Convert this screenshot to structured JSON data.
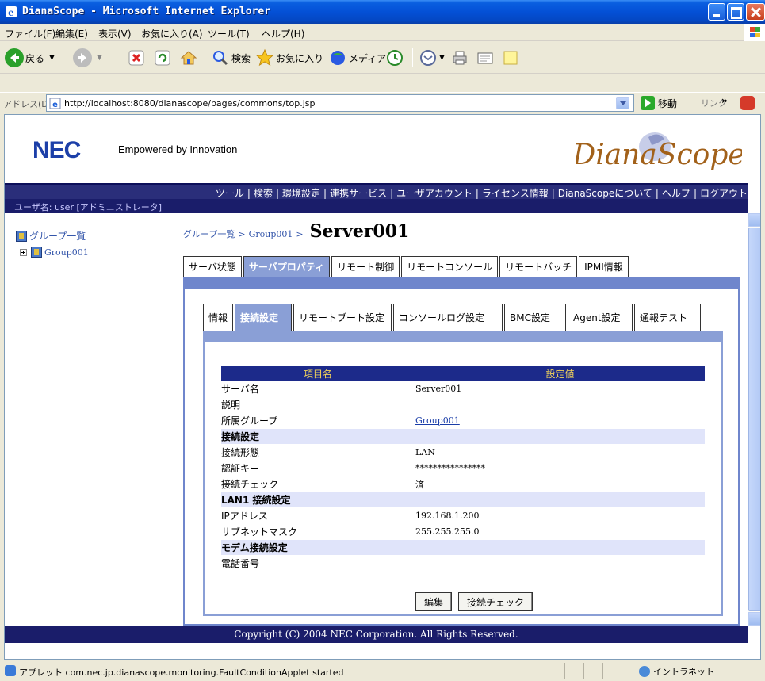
{
  "window": {
    "title": "DianaScope - Microsoft Internet Explorer"
  },
  "menubar": {
    "items": [
      "ファイル(F)",
      "編集(E)",
      "表示(V)",
      "お気に入り(A)",
      "ツール(T)",
      "ヘルプ(H)"
    ]
  },
  "toolbar": {
    "back_label": "戻る",
    "search_label": "検索",
    "favorites_label": "お気に入り",
    "media_label": "メディア"
  },
  "address": {
    "label": "アドレス(D)",
    "url": "http://localhost:8080/dianascope/pages/commons/top.jsp",
    "go_label": "移動",
    "links_label": "リンク"
  },
  "banner": {
    "logo": "NEC",
    "tagline": "Empowered by Innovation",
    "product_logo": "DianaScope"
  },
  "nav": {
    "links": [
      "ツール",
      "検索",
      "環境設定",
      "連携サービス",
      "ユーザアカウント",
      "ライセンス情報",
      "DianaScopeについて",
      "ヘルプ",
      "ログアウト"
    ]
  },
  "user": {
    "text": "ユーザ名: user [アドミニストレータ]"
  },
  "sidebar": {
    "root_label": "グループ一覧",
    "child_label": "Group001"
  },
  "breadcrumb": {
    "root": "グループ一覧",
    "separator": ">",
    "group": "Group001",
    "server": "Server001"
  },
  "main_tabs": [
    "サーバ状態",
    "サーバプロパティ",
    "リモート制御",
    "リモートコンソール",
    "リモートバッチ",
    "IPMI情報"
  ],
  "sub_tabs": [
    "情報",
    "接続設定",
    "リモートブート設定",
    "コンソールログ設定",
    "BMC設定",
    "Agent設定",
    "通報テスト"
  ],
  "table": {
    "header_key": "項目名",
    "header_value": "設定値",
    "rows": [
      {
        "key": "サーバ名",
        "value": "Server001",
        "section": false
      },
      {
        "key": "説明",
        "value": "",
        "section": false
      },
      {
        "key": "所属グループ",
        "value": "Group001",
        "section": false,
        "link": true
      },
      {
        "key": "接続設定",
        "value": "",
        "section": true
      },
      {
        "key": "接続形態",
        "value": "LAN",
        "section": false
      },
      {
        "key": "認証キー",
        "value": "****************",
        "section": false
      },
      {
        "key": "接続チェック",
        "value": "済",
        "section": false
      },
      {
        "key": "LAN1 接続設定",
        "value": "",
        "section": true
      },
      {
        "key": "IPアドレス",
        "value": "192.168.1.200",
        "section": false
      },
      {
        "key": "サブネットマスク",
        "value": "255.255.255.0",
        "section": false
      },
      {
        "key": "モデム接続設定",
        "value": "",
        "section": true
      },
      {
        "key": "電話番号",
        "value": "",
        "section": false
      }
    ]
  },
  "buttons": {
    "edit": "編集",
    "check": "接続チェック"
  },
  "footer": {
    "text": "Copyright (C) 2004 NEC Corporation. All Rights Reserved."
  },
  "status": {
    "message": "アプレット com.nec.jp.dianascope.monitoring.FaultConditionApplet started",
    "zone": "イントラネット"
  },
  "colors": {
    "nav_bg": "#2a2e7a",
    "tab_active": "#8a9fd6",
    "table_header": "#1c2a8a",
    "table_header_text": "#f5d55a",
    "section_bg": "#e0e4fa"
  }
}
